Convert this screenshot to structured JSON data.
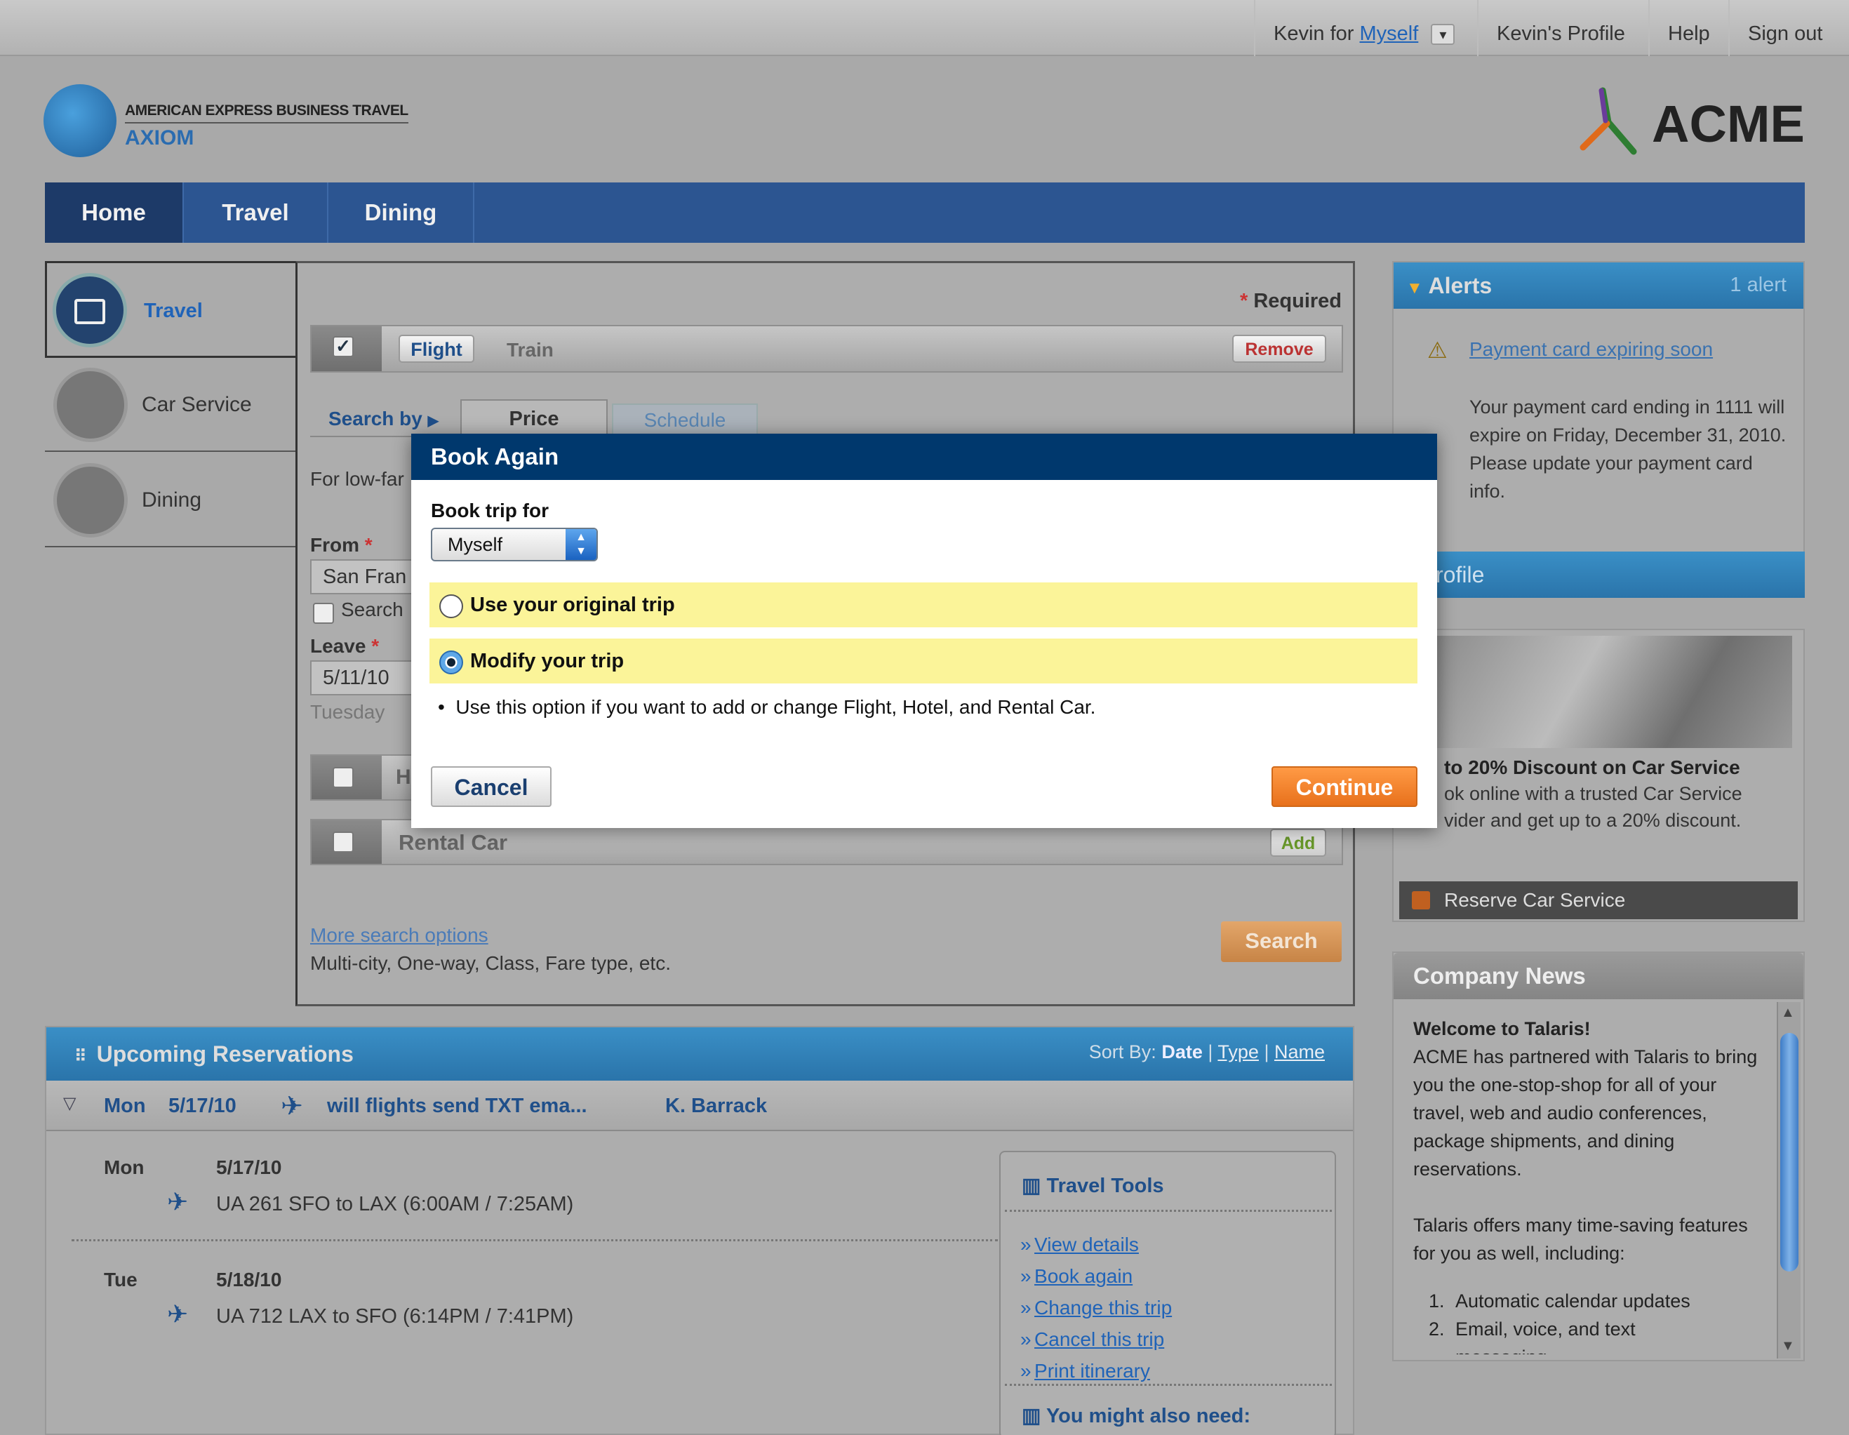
{
  "topbar": {
    "user_prefix": "Kevin for",
    "user_for": "Myself",
    "dropdown_glyph": "▾",
    "profile": "Kevin's Profile",
    "help": "Help",
    "signout": "Sign out"
  },
  "brand": {
    "amex_line": "AMERICAN EXPRESS BUSINESS TRAVEL",
    "axiom": "AXIOM",
    "acme": "ACME"
  },
  "nav": {
    "tabs": [
      "Home",
      "Travel",
      "Dining"
    ]
  },
  "left_menu": {
    "items": [
      "Travel",
      "Car Service",
      "Dining"
    ]
  },
  "search": {
    "required_star": "*",
    "required_label": "Required",
    "checkmark": "✓",
    "flight_tab": "Flight",
    "train_tab": "Train",
    "remove": "Remove",
    "search_by": "Search by",
    "price_tab": "Price",
    "schedule_tab": "Schedule",
    "low_fare_text": "For low-far",
    "from_label": "From",
    "star": "*",
    "from_value": "San Fran",
    "search_nearby": "Search",
    "leave_label": "Leave",
    "leave_value": "5/11/10",
    "leave_day": "Tuesday",
    "hotel_row_letter": "H",
    "rental_car": "Rental Car",
    "add": "Add",
    "more_options": "More search options",
    "more_options_desc": "Multi-city, One-way, Class, Fare type, etc.",
    "search_button": "Search"
  },
  "reservations": {
    "title": "Upcoming Reservations",
    "sort_by": "Sort By:",
    "sort_date": "Date",
    "sort_type": "Type",
    "sort_name": "Name",
    "summary_day": "Mon",
    "summary_date": "5/17/10",
    "summary_name": "will flights send TXT ema...",
    "summary_traveler": "K. Barrack",
    "trips": [
      {
        "day": "Mon",
        "date": "5/17/10",
        "flight": "UA 261 SFO to LAX (6:00AM / 7:25AM)"
      },
      {
        "day": "Tue",
        "date": "5/18/10",
        "flight": "UA 712 LAX to SFO (6:14PM / 7:41PM)"
      }
    ],
    "tools_title": "Travel Tools",
    "tools": [
      "View details",
      "Book again",
      "Change this trip",
      "Cancel this trip",
      "Print itinerary"
    ],
    "tools_prefix": "»",
    "also_need": "You might also need:"
  },
  "alerts": {
    "title": "Alerts",
    "count": "1 alert",
    "link": "Payment card expiring soon",
    "body": "Your payment card ending in 1111 will expire on Friday, December 31, 2010. Please update your payment card info."
  },
  "profile": {
    "title": "rofile",
    "promo_title": "to 20% Discount on Car Service",
    "promo_line1": "ok online with a trusted Car Service",
    "promo_line2": "vider and get up to a 20% discount.",
    "reserve": "Reserve Car Service"
  },
  "news": {
    "title": "Company News",
    "heading": "Welcome to Talaris!",
    "para1": "ACME has partnered with Talaris to bring you the one-stop-shop for all of your travel, web and audio conferences, package shipments, and dining reservations.",
    "para2": "Talaris offers many time-saving features for you as well, including:",
    "items": [
      "Automatic calendar updates",
      "Email, voice, and text",
      "messaging"
    ]
  },
  "modal": {
    "title": "Book Again",
    "book_for_label": "Book trip for",
    "book_for_value": "Myself",
    "option1": "Use your original trip",
    "option2": "Modify your trip",
    "bullet": "Use this option if you want to add or change Flight, Hotel, and Rental Car.",
    "cancel": "Cancel",
    "continue": "Continue",
    "selected_option": "Modify your trip"
  }
}
